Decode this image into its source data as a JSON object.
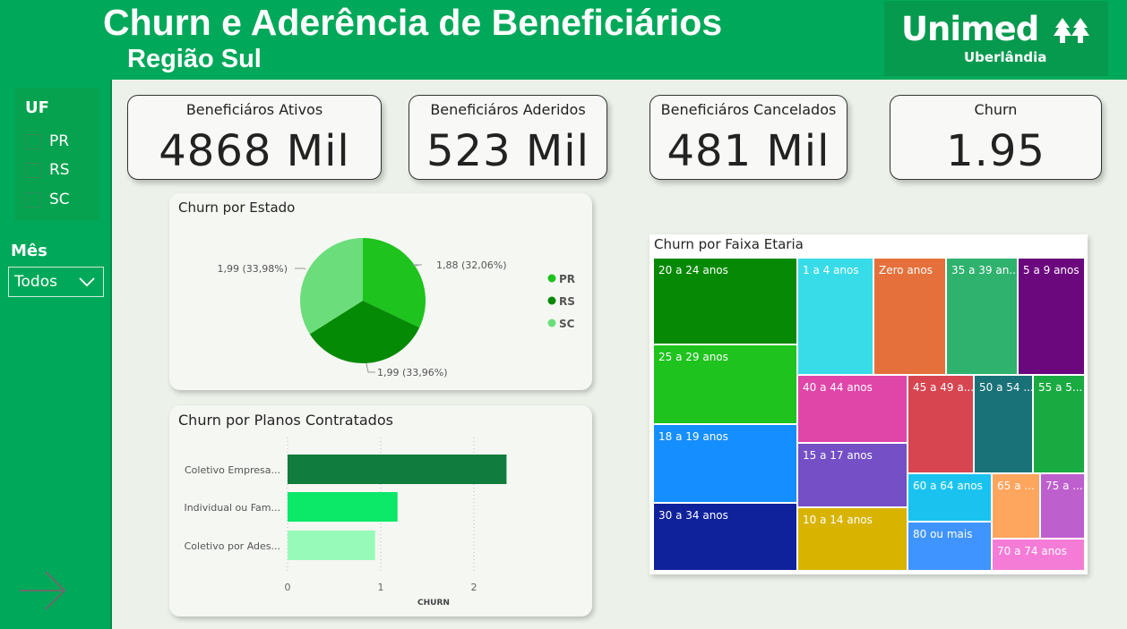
{
  "header": {
    "title": "Churn e Aderência de Beneficiários",
    "subtitle": "Região Sul",
    "logo_main": "Unimed",
    "logo_sub": "Uberlândia"
  },
  "filters": {
    "uf_title": "UF",
    "uf_options": [
      "PR",
      "RS",
      "SC"
    ],
    "mes_title": "Mês",
    "mes_value": "Todos"
  },
  "kpis": [
    {
      "label": "Beneficiáros Ativos",
      "value": "4868 Mil"
    },
    {
      "label": "Beneficiáros Aderidos",
      "value": "523 Mil"
    },
    {
      "label": "Beneficiáros Cancelados",
      "value": "481 Mil"
    },
    {
      "label": "Churn",
      "value": "1.95"
    }
  ],
  "icons": {
    "nav_arrow": "arrow-right-icon",
    "dropdown": "chevron-down-icon",
    "logo_mark": "unimed-tree-icon"
  },
  "chart_data": [
    {
      "type": "pie",
      "title": "Churn por Estado",
      "slices": [
        {
          "label": "PR",
          "value": 1.88,
          "display": "1,88 (32,06%)",
          "color": "#1ec31e"
        },
        {
          "label": "RS",
          "value": 1.99,
          "display": "1,99 (33,96%)",
          "color": "#058a05"
        },
        {
          "label": "SC",
          "value": 1.99,
          "display": "1,99 (33,98%)",
          "color": "#6bde7b"
        }
      ],
      "legend": [
        "PR",
        "RS",
        "SC"
      ],
      "legend_position": "right"
    },
    {
      "type": "bar",
      "orientation": "horizontal",
      "title": "Churn por Planos Contratados",
      "categories": [
        "Coletivo Empresa...",
        "Individual ou Fam...",
        "Coletivo por Ades..."
      ],
      "values": [
        2.35,
        1.18,
        0.94
      ],
      "colors": [
        "#107c3d",
        "#0ce867",
        "#97fab8"
      ],
      "xlabel": "CHURN",
      "xticks": [
        "0",
        "1",
        "2"
      ],
      "xlim": [
        0,
        2.5
      ],
      "grid": true
    },
    {
      "type": "treemap",
      "title": "Churn por Faixa Etaria",
      "tiles": [
        {
          "label": "20 a 24 anos",
          "color": "#068a05"
        },
        {
          "label": "25 a 29 anos",
          "color": "#1ec31e"
        },
        {
          "label": "18 a 19 anos",
          "color": "#158eff"
        },
        {
          "label": "30 a 34 anos",
          "color": "#10219c"
        },
        {
          "label": "1 a 4 anos",
          "color": "#38dce8"
        },
        {
          "label": "Zero anos",
          "color": "#e5703b"
        },
        {
          "label": "35 a 39 an...",
          "color": "#2fb26e"
        },
        {
          "label": "5 a 9 anos",
          "color": "#6b087d"
        },
        {
          "label": "40 a 44 anos",
          "color": "#df46a8"
        },
        {
          "label": "15 a 17 anos",
          "color": "#744fc6"
        },
        {
          "label": "10 a 14 anos",
          "color": "#d8b300"
        },
        {
          "label": "45 a 49 a...",
          "color": "#d64550"
        },
        {
          "label": "50 a 54 ...",
          "color": "#197278"
        },
        {
          "label": "55 a 5...",
          "color": "#1aaa42"
        },
        {
          "label": "60 a 64 anos",
          "color": "#1ac3ef"
        },
        {
          "label": "80 ou mais",
          "color": "#4094ff"
        },
        {
          "label": "65 a ...",
          "color": "#fea55e"
        },
        {
          "label": "75 a ...",
          "color": "#be5fce"
        },
        {
          "label": "70 a 74 anos",
          "color": "#f57cd6"
        }
      ]
    }
  ]
}
